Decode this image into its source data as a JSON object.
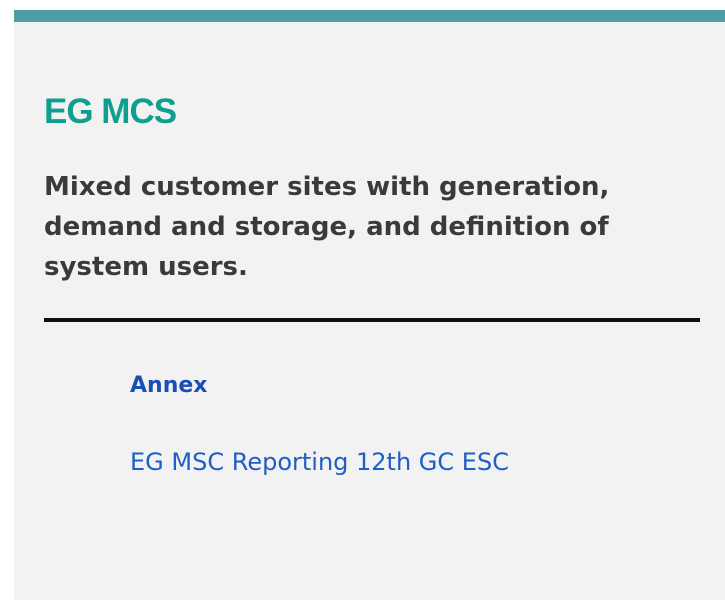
{
  "card": {
    "title": "EG MCS",
    "description": "Mixed customer sites with generation, demand and storage, and definition of system users.",
    "annex": {
      "heading": "Annex",
      "link_label": "EG MSC Reporting 12th GC ESC"
    }
  },
  "colors": {
    "accent_bar": "#4f9ea7",
    "title": "#0e9f8e",
    "description": "#3a3a3a",
    "annex_heading": "#1a4fb5",
    "link": "#1f5fc5",
    "card_background": "#f2f2f2"
  }
}
